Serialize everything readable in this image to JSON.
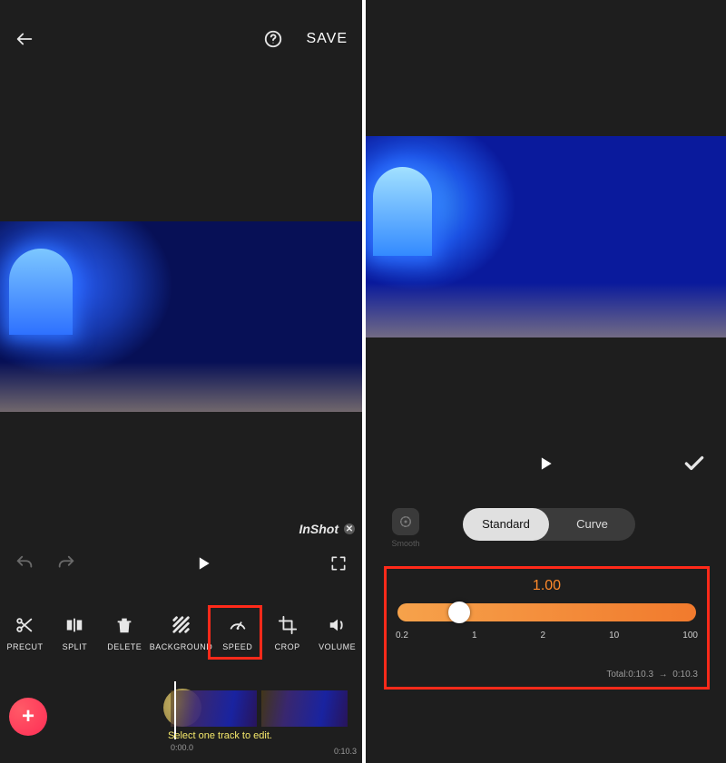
{
  "left": {
    "save_label": "SAVE",
    "watermark": "InShot",
    "tools": {
      "precut": "PRECUT",
      "split": "SPLIT",
      "delete": "DELETE",
      "background": "BACKGROUND",
      "speed": "SPEED",
      "crop": "CROP",
      "volume": "VOLUME"
    },
    "track_hint": "Select one track to edit.",
    "time_start": "0:00.0",
    "time_end": "0:10.3"
  },
  "right": {
    "smooth_label": "Smooth",
    "tabs": {
      "standard": "Standard",
      "curve": "Curve"
    },
    "speed_value": "1.00",
    "ticks": {
      "t1": "0.2",
      "t2": "1",
      "t3": "2",
      "t4": "10",
      "t5": "100"
    },
    "total_prefix": "Total:",
    "total_from": "0:10.3",
    "total_arrow": "→",
    "total_to": "0:10.3"
  }
}
